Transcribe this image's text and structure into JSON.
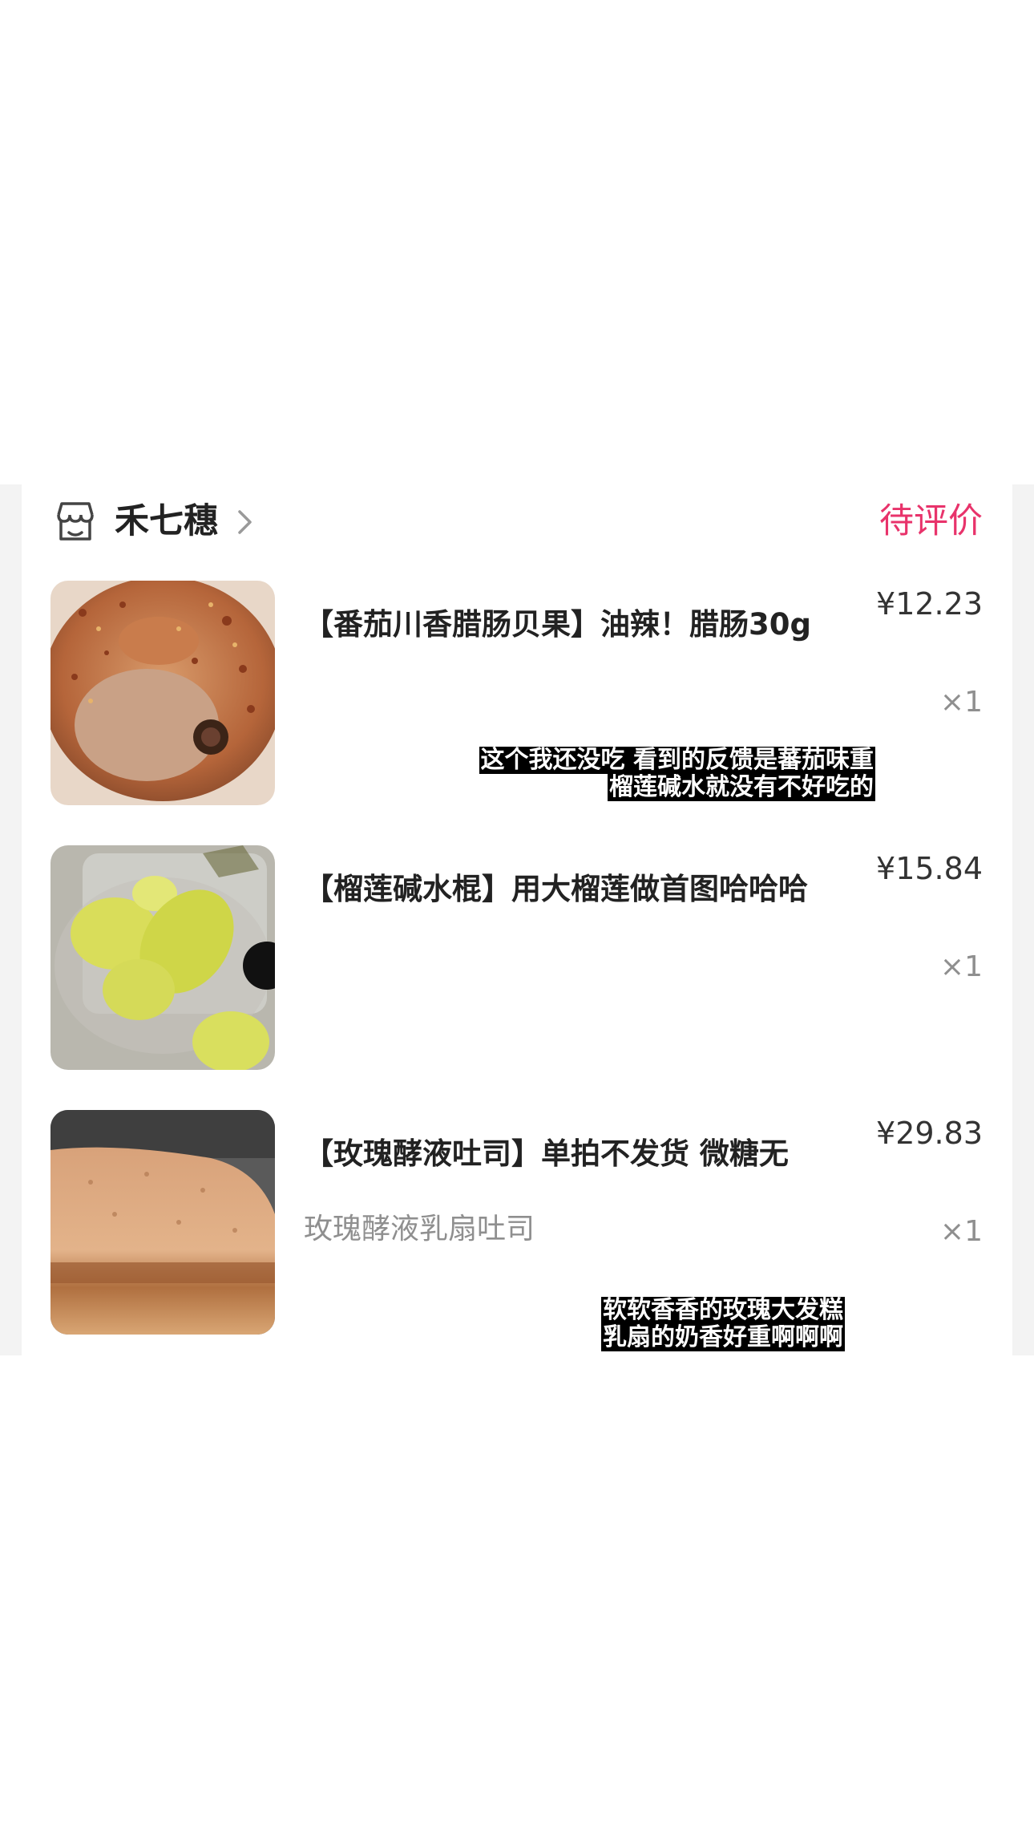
{
  "shop": {
    "name": "禾七穗",
    "icon": "shop-icon",
    "status": "待评价",
    "status_color": "#e8336b"
  },
  "items": [
    {
      "title": "【番茄川香腊肠贝果】油辣！腊肠30g",
      "spec": "",
      "price": "¥12.23",
      "qty": "×1",
      "image": "bagel-photo",
      "caption": [
        "这个我还没吃  看到的反馈是蕃茄味重",
        "榴莲碱水就没有不好吃的"
      ]
    },
    {
      "title": "【榴莲碱水棍】用大榴莲做首图哈哈哈",
      "spec": "",
      "price": "¥15.84",
      "qty": "×1",
      "image": "durian-photo",
      "caption": []
    },
    {
      "title": "【玫瑰酵液吐司】单拍不发货 微糖无",
      "spec": "玫瑰酵液乳扇吐司",
      "price": "¥29.83",
      "qty": "×1",
      "image": "toast-photo",
      "caption": [
        "软软香香的玫瑰大发糕",
        "乳扇的奶香好重啊啊啊"
      ]
    }
  ]
}
